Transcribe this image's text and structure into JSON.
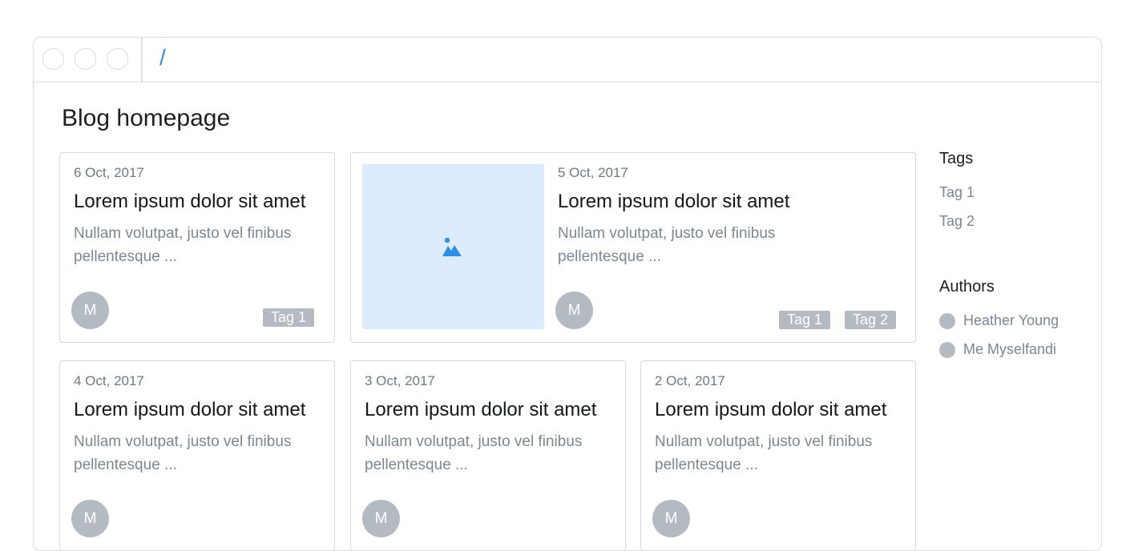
{
  "browser": {
    "url": "/"
  },
  "page": {
    "title": "Blog homepage"
  },
  "posts": [
    {
      "date": "6 Oct, 2017",
      "title": "Lorem ipsum dolor sit amet",
      "excerpt": "Nullam volutpat, justo vel finibus pellentesque ...",
      "author_initial": "M",
      "tags": [
        "Tag 1"
      ]
    },
    {
      "date": "5 Oct, 2017",
      "title": "Lorem ipsum dolor sit amet",
      "excerpt": "Nullam volutpat, justo vel finibus pellentesque ...",
      "author_initial": "M",
      "tags": [
        "Tag 1",
        "Tag 2"
      ],
      "image_icon": "image-placeholder-icon"
    },
    {
      "date": "4 Oct, 2017",
      "title": "Lorem ipsum dolor sit amet",
      "excerpt": "Nullam volutpat, justo vel finibus pellentesque ...",
      "author_initial": "M"
    },
    {
      "date": "3 Oct, 2017",
      "title": "Lorem ipsum dolor sit amet",
      "excerpt": "Nullam volutpat, justo vel finibus pellentesque ...",
      "author_initial": "M"
    },
    {
      "date": "2 Oct, 2017",
      "title": "Lorem ipsum dolor sit amet",
      "excerpt": "Nullam volutpat, justo vel finibus pellentesque ...",
      "author_initial": "M"
    }
  ],
  "sidebar": {
    "tags_heading": "Tags",
    "tags": [
      "Tag 1",
      "Tag 2"
    ],
    "authors_heading": "Authors",
    "authors": [
      "Heather Young",
      "Me Myselfandi"
    ]
  },
  "colors": {
    "accent": "#2f8fe6",
    "placeholder_bg": "#dcecfc",
    "muted": "#b4bac2"
  }
}
